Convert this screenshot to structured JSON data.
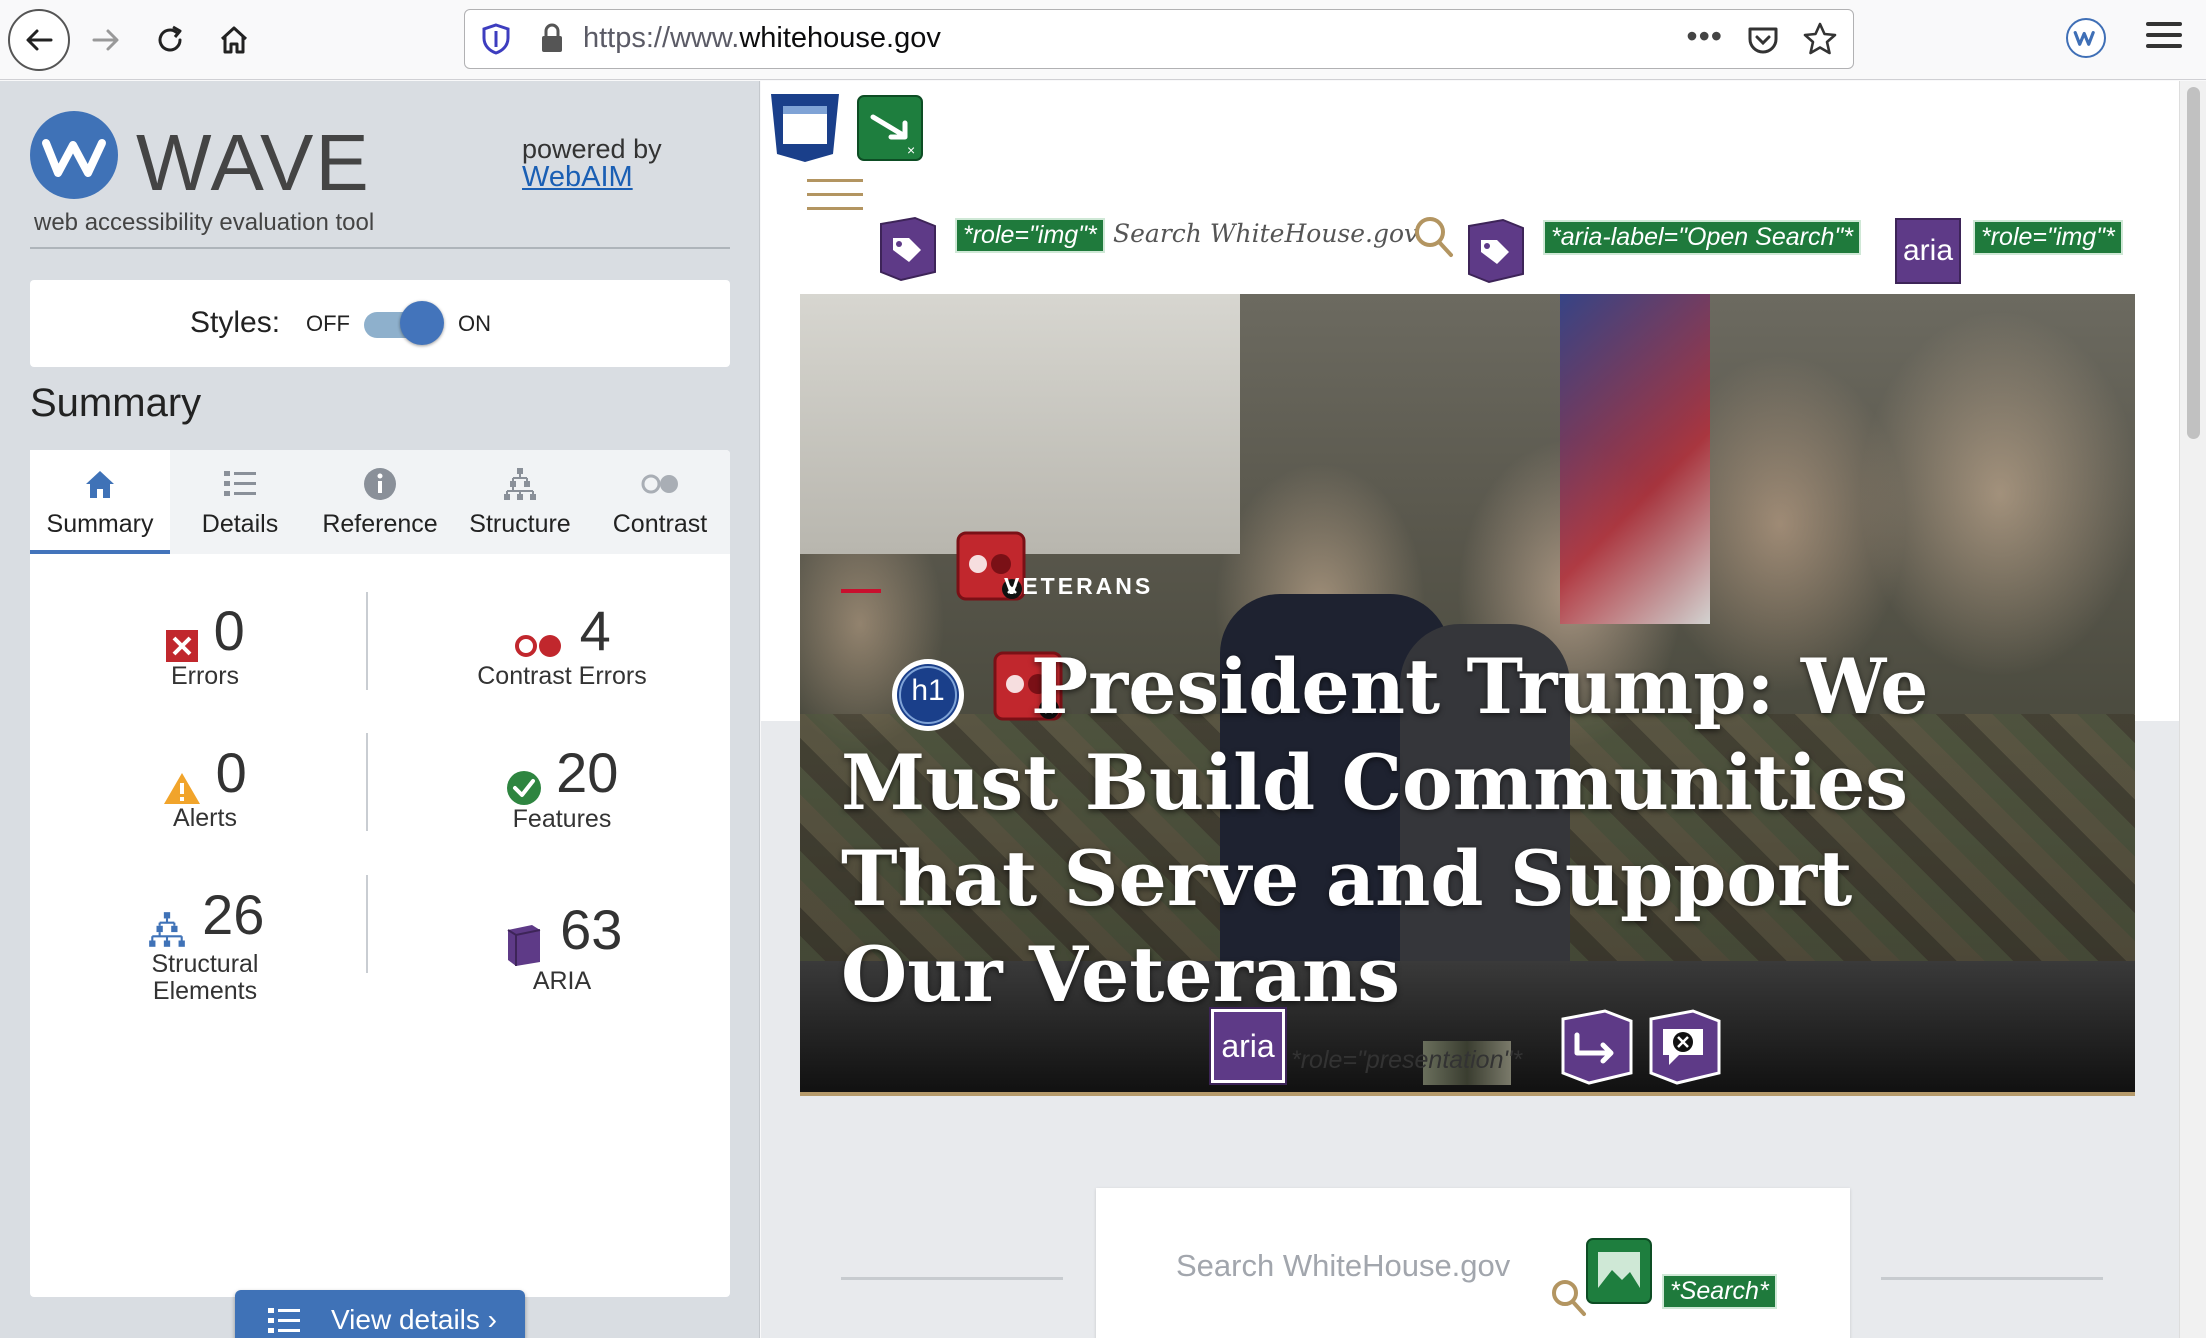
{
  "browser": {
    "url_prefix": "https://www.",
    "url_host": "whitehouse.gov",
    "more_glyph": "•••"
  },
  "wave": {
    "logo_word": "WAVE",
    "subtitle": "web accessibility evaluation tool",
    "powered_by": "powered by",
    "webaim_link": "WebAIM",
    "styles_label": "Styles:",
    "styles_off": "OFF",
    "styles_on": "ON",
    "summary_heading": "Summary",
    "tabs": [
      {
        "label": "Summary",
        "icon": "home-icon",
        "active": true
      },
      {
        "label": "Details",
        "icon": "list-icon",
        "active": false
      },
      {
        "label": "Reference",
        "icon": "info-icon",
        "active": false
      },
      {
        "label": "Structure",
        "icon": "hierarchy-icon",
        "active": false
      },
      {
        "label": "Contrast",
        "icon": "contrast-icon",
        "active": false
      }
    ],
    "stats": {
      "errors": {
        "count": "0",
        "label": "Errors"
      },
      "contrast_errors": {
        "count": "4",
        "label": "Contrast Errors"
      },
      "alerts": {
        "count": "0",
        "label": "Alerts"
      },
      "features": {
        "count": "20",
        "label": "Features"
      },
      "structural": {
        "count": "26",
        "label1": "Structural",
        "label2": "Elements"
      },
      "aria": {
        "count": "63",
        "label": "ARIA"
      }
    },
    "view_details": "View details ›",
    "colors": {
      "brand_blue": "#3f72b7",
      "error_red": "#c1272d",
      "alert_orange": "#f1a42b",
      "feature_green": "#2e8540",
      "aria_purple": "#5e3a87"
    }
  },
  "page": {
    "labels": {
      "role_img_1": "*role=\"img\"*",
      "search_whitehouse": "Search WhiteHouse.gov",
      "aria_label_open_search": "*aria-label=\"Open Search\"*",
      "role_img_2": "*role=\"img\"*",
      "aria_badge": "aria",
      "aria_badge_2": "aria",
      "h1_badge": "h1",
      "role_presentation": "*role=\"presentation\"*",
      "search_label": "*Search*"
    },
    "hero": {
      "category": "VETERANS",
      "headline": "President Trump: We Must Build Communities That Serve and Support Our Veterans"
    },
    "search_placeholder": "Search WhiteHouse.gov"
  }
}
